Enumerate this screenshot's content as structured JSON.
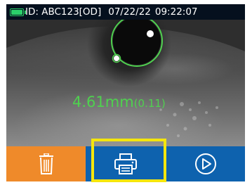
{
  "status": {
    "id_text": "ID: ABC123[OD]",
    "date": "07/22/22",
    "time": "09:22:07",
    "battery_icon": "battery-icon",
    "battery_color": "#2bd06a"
  },
  "measurement": {
    "value": "4.61mm",
    "deviation": "(0.11)",
    "color": "#4fd14f"
  },
  "toolbar": {
    "delete_icon": "trash-icon",
    "print_icon": "printer-icon",
    "play_icon": "play-circle-icon",
    "delete_color": "#ef8a2a",
    "action_color": "#0e62ae",
    "highlight_color": "#f5e60c"
  }
}
